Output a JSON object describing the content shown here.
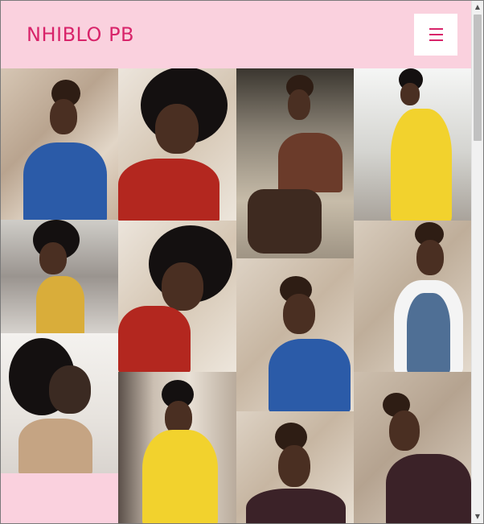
{
  "header": {
    "site_title": "NHIBLO PB",
    "menu_icon": "hamburger-icon"
  },
  "colors": {
    "header_bg": "#fad1de",
    "accent": "#d8246a",
    "menu_bg": "#ffffff"
  },
  "gallery": {
    "photos": [
      {
        "id": "p1",
        "top": "#2b5ba8"
      },
      {
        "id": "p2",
        "top": "#b3271f"
      },
      {
        "id": "p3",
        "top": "#6b3b2a"
      },
      {
        "id": "p4",
        "top": "#f2d22d"
      },
      {
        "id": "p5",
        "top": "#d9ad3a"
      },
      {
        "id": "p6",
        "top": "#b3271f"
      },
      {
        "id": "p7",
        "top": "#2b5ba8"
      },
      {
        "id": "p8",
        "top": "#4f6f95"
      },
      {
        "id": "p9",
        "top": "#c5a483"
      },
      {
        "id": "p10",
        "top": "#f2d22d"
      },
      {
        "id": "p11",
        "top": "#3b2228"
      },
      {
        "id": "p12",
        "top": "#3b2228"
      }
    ]
  },
  "scrollbar": {
    "up_icon": "arrow-up-icon",
    "down_icon": "arrow-down-icon"
  }
}
